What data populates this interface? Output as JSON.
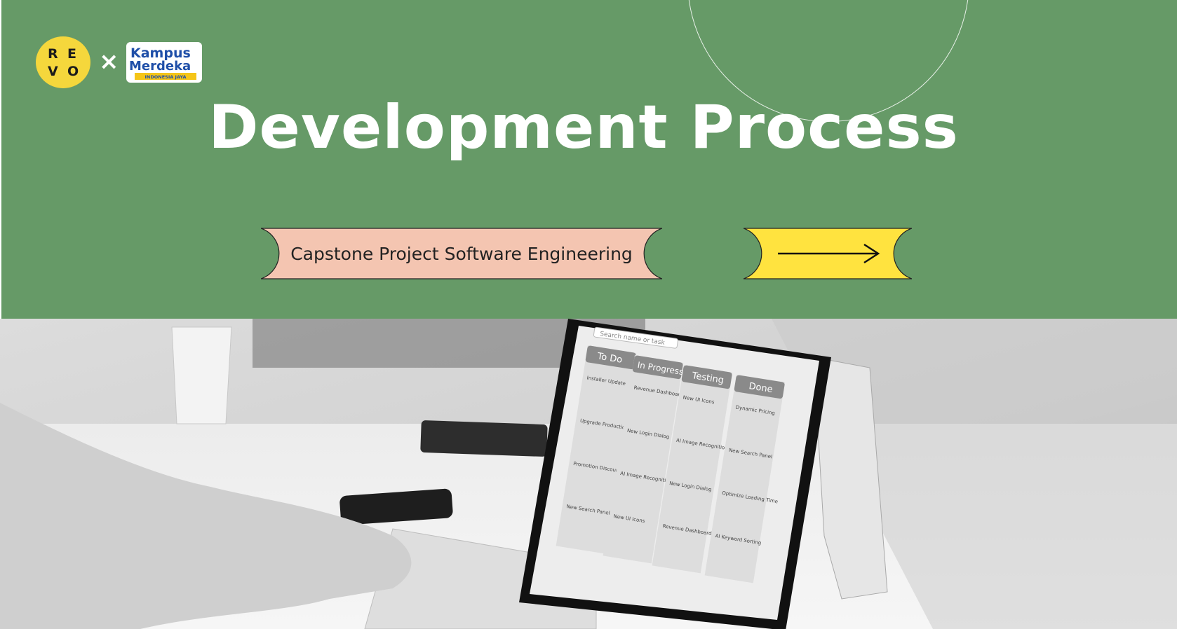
{
  "header": {
    "logo_revo_letters": [
      "R",
      "E",
      "V",
      "O"
    ],
    "separator": "×",
    "logo_partner_lines": [
      "Kampus",
      "Merdeka",
      "INDONESIA JAYA"
    ],
    "title": "Development Process"
  },
  "pill": {
    "label": "Capstone Project Software Engineering"
  },
  "kanban": {
    "search_placeholder": "Search name or task",
    "columns": [
      {
        "title": "To Do",
        "cards": [
          "Installer Update",
          "Upgrade Production Server",
          "Promotion Discounts",
          "New Search Panel"
        ]
      },
      {
        "title": "In Progress",
        "cards": [
          "Revenue Dashboard",
          "New Login Dialog",
          "AI Image Recognition",
          "New UI Icons"
        ]
      },
      {
        "title": "Testing",
        "cards": [
          "New UI Icons",
          "AI Image Recognition",
          "New Login Dialog",
          "Revenue Dashboard"
        ]
      },
      {
        "title": "Done",
        "cards": [
          "Dynamic Pricing",
          "New Search Panel",
          "Optimize Loading Time",
          "AI Keyword Sorting"
        ]
      }
    ]
  },
  "colors": {
    "background_green": "#669a67",
    "pill_pink": "#f4c5b1",
    "pill_yellow": "#ffe33f",
    "revo_yellow": "#f5d73c",
    "partner_blue": "#1f4fa8"
  }
}
